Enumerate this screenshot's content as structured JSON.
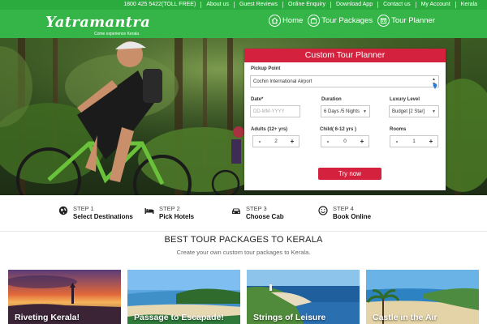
{
  "topbar": {
    "links": [
      "1800 425 5422(TOLL FREE)",
      "About us",
      "Guest Reviews",
      "Online Enquiry",
      "Download App",
      "Contact us",
      "My Account",
      "Kerala"
    ]
  },
  "header": {
    "logo_text": "Yatramantra",
    "logo_tagline": "Come experience Kerala",
    "nav": [
      {
        "label": "Home",
        "icon": "home-icon"
      },
      {
        "label": "Tour Packages",
        "icon": "packages-icon"
      },
      {
        "label": "Tour Planner",
        "icon": "planner-icon"
      }
    ]
  },
  "planner": {
    "title": "Custom Tour Planner",
    "pickup_label": "Pickup Point",
    "pickup_value": "Cochin International Airport",
    "date_label": "Date*",
    "date_placeholder": "DD-MM-YYYY",
    "duration_label": "Duration",
    "duration_value": "6 Days /5 Nights",
    "luxury_label": "Luxury Level",
    "luxury_value": "Budget [2 Star]",
    "adults_label": "Adults (12+ yrs)",
    "adults_value": "2",
    "child_label": "Child( 6-12 yrs )",
    "child_value": "0",
    "rooms_label": "Rooms",
    "rooms_value": "1",
    "minus": "-",
    "plus": "+",
    "button": "Try now"
  },
  "steps": [
    {
      "num": "STEP 1",
      "title": "Select Destinations",
      "icon": "globe-icon"
    },
    {
      "num": "STEP 2",
      "title": "Pick Hotels",
      "icon": "bed-icon"
    },
    {
      "num": "STEP 3",
      "title": "Choose Cab",
      "icon": "car-icon"
    },
    {
      "num": "STEP 4",
      "title": "Book Online",
      "icon": "smiley-icon"
    }
  ],
  "packages": {
    "title": "BEST TOUR PACKAGES TO KERALA",
    "subtitle": "Create your own custom tour packages to Kerala.",
    "cards": [
      {
        "title": "Riveting Kerala!"
      },
      {
        "title": "Passage to Escapade!"
      },
      {
        "title": "Strings of Leisure"
      },
      {
        "title": "Castle in the Air"
      }
    ]
  },
  "colors": {
    "brand_green": "#35b548",
    "accent_red": "#d3213e"
  }
}
